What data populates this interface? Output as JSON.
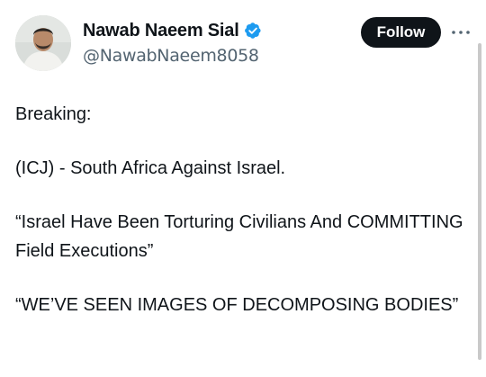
{
  "tweet": {
    "author": {
      "display_name": "Nawab Naeem Sial",
      "handle": "@NawabNaeem8058",
      "verified": true,
      "verified_color": "#1d9bf0"
    },
    "follow_label": "Follow",
    "more_icon": "more-horizontal-icon",
    "paragraphs": [
      "Breaking:",
      "(ICJ) - South Africa Against Israel.",
      "“Israel Have Been Torturing Civilians And COMMITTING Field Executions”",
      "“WE’VE SEEN IMAGES OF DECOMPOSING BODIES”"
    ]
  }
}
